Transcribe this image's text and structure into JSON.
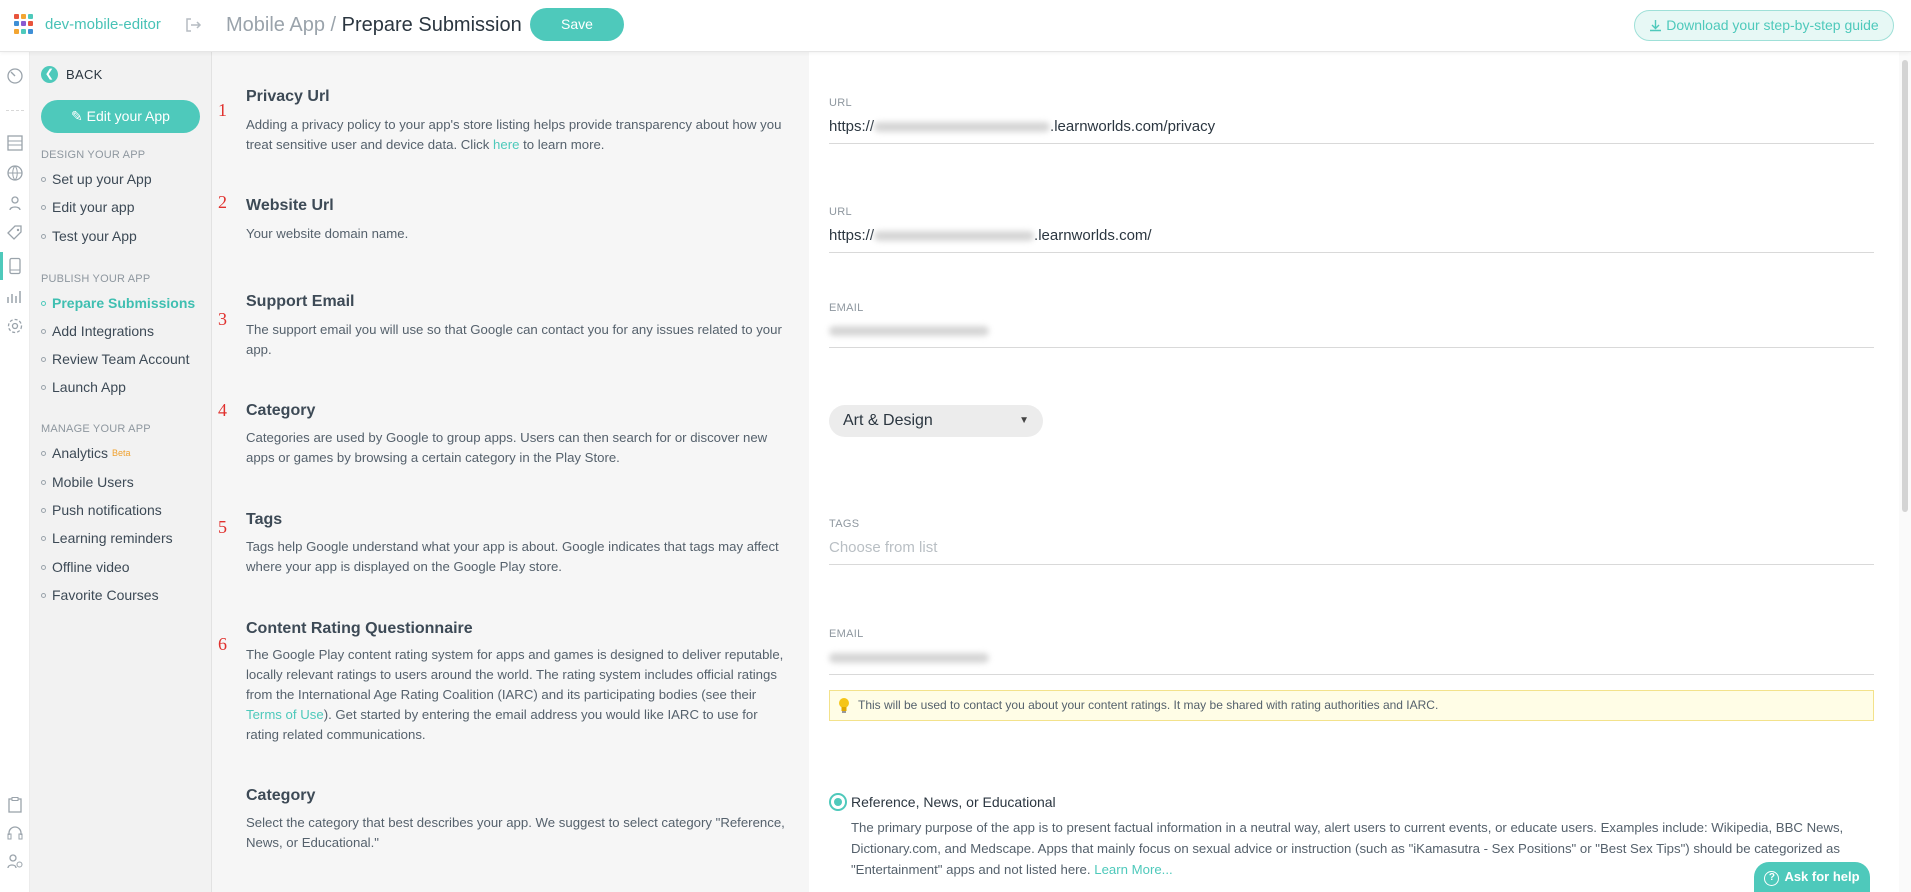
{
  "app": {
    "name": "dev-mobile-editor"
  },
  "header": {
    "breadcrumb_parent": "Mobile App /",
    "title": "Prepare Submission",
    "save_label": "Save",
    "download_label": "Download your step-by-step guide"
  },
  "sidebar": {
    "back_label": "BACK",
    "edit_app_label": "Edit your App",
    "design_title": "DESIGN YOUR APP",
    "design_items": [
      "Set up your App",
      "Edit your app",
      "Test your App"
    ],
    "publish_title": "PUBLISH YOUR APP",
    "publish_items": [
      "Prepare Submissions",
      "Add Integrations",
      "Review Team Account",
      "Launch App"
    ],
    "manage_title": "MANAGE YOUR APP",
    "manage_items": [
      "Analytics",
      "Mobile Users",
      "Push notifications",
      "Learning reminders",
      "Offline video",
      "Favorite Courses"
    ],
    "beta_label": "Beta"
  },
  "sections": {
    "privacy": {
      "number": "1",
      "title": "Privacy Url",
      "desc_pre": "Adding a privacy policy to your app's store listing helps provide transparency about how you treat sensitive user and device data. Click ",
      "desc_link": "here",
      "desc_post": " to learn more.",
      "field_label": "URL",
      "value_prefix": "https://",
      "value_suffix": ".learnworlds.com/privacy"
    },
    "website": {
      "number": "2",
      "title": "Website Url",
      "desc": "Your website domain name.",
      "field_label": "URL",
      "value_prefix": "https://",
      "value_suffix": ".learnworlds.com/"
    },
    "support": {
      "number": "3",
      "title": "Support Email",
      "desc": "The support email you will use so that Google can contact you for any issues related to your app.",
      "field_label": "EMAIL"
    },
    "category": {
      "number": "4",
      "title": "Category",
      "desc": "Categories are used by Google to group apps. Users can then search for or discover new apps or games by browsing a certain category in the Play Store.",
      "selected": "Art & Design"
    },
    "tags": {
      "number": "5",
      "title": "Tags",
      "desc": "Tags help Google understand what your app is about. Google indicates that tags may affect where your app is displayed on the Google Play store.",
      "field_label": "TAGS",
      "placeholder": "Choose from list"
    },
    "rating": {
      "number": "6",
      "title": "Content Rating Questionnaire",
      "desc_pre": "The Google Play content rating system for apps and games is designed to deliver reputable, locally relevant ratings to users around the world. The rating system includes official ratings from the International Age Rating Coalition (IARC) and its participating bodies (see their ",
      "desc_link": "Terms of Use",
      "desc_post": "). Get started by entering the email address you would like IARC to use for rating related communications.",
      "field_label": "EMAIL",
      "hint": "This will be used to contact you about your content ratings. It may be shared with rating authorities and IARC."
    },
    "rating_category": {
      "title": "Category",
      "desc": "Select the category that best describes your app. We suggest to select category \"Reference, News, or Educational.\"",
      "option_label": "Reference, News, or Educational",
      "option_desc": "The primary purpose of the app is to present factual information in a neutral way, alert users to current events, or educate users. Examples include: Wikipedia, BBC News, Dictionary.com, and Medscape. Apps that mainly focus on sexual advice or instruction (such as \"iKamasutra - Sex Positions\" or \"Best Sex Tips\") should be categorized as \"Entertainment\" apps and not listed here.",
      "learn_more": "Learn More..."
    }
  },
  "help": {
    "label": "Ask for help"
  },
  "colors": {
    "accent": "#4ec9bb",
    "step_number": "#e0312e",
    "hint_bg": "#fffde6"
  }
}
